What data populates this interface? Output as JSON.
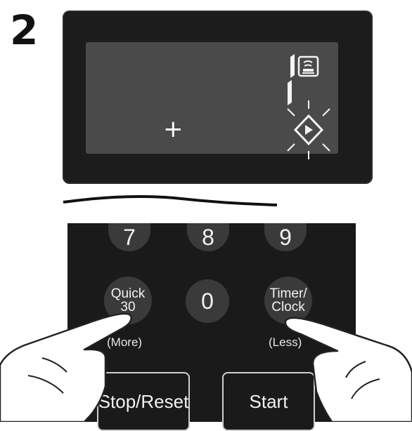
{
  "step": {
    "number": "2"
  },
  "display": {
    "symbol": "+",
    "indicators": [
      "oven-power-icon",
      "start-diamond-icon"
    ]
  },
  "keypad": {
    "keys": {
      "seven": "7",
      "eight": "8",
      "nine": "9",
      "zero": "0",
      "quick_line1": "Quick",
      "quick_line2": "30",
      "quick_sub": "(More)",
      "timer_line1": "Timer/",
      "timer_line2": "Clock",
      "timer_sub": "(Less)"
    },
    "buttons": {
      "stop_reset": "Stop/Reset",
      "start": "Start"
    }
  }
}
